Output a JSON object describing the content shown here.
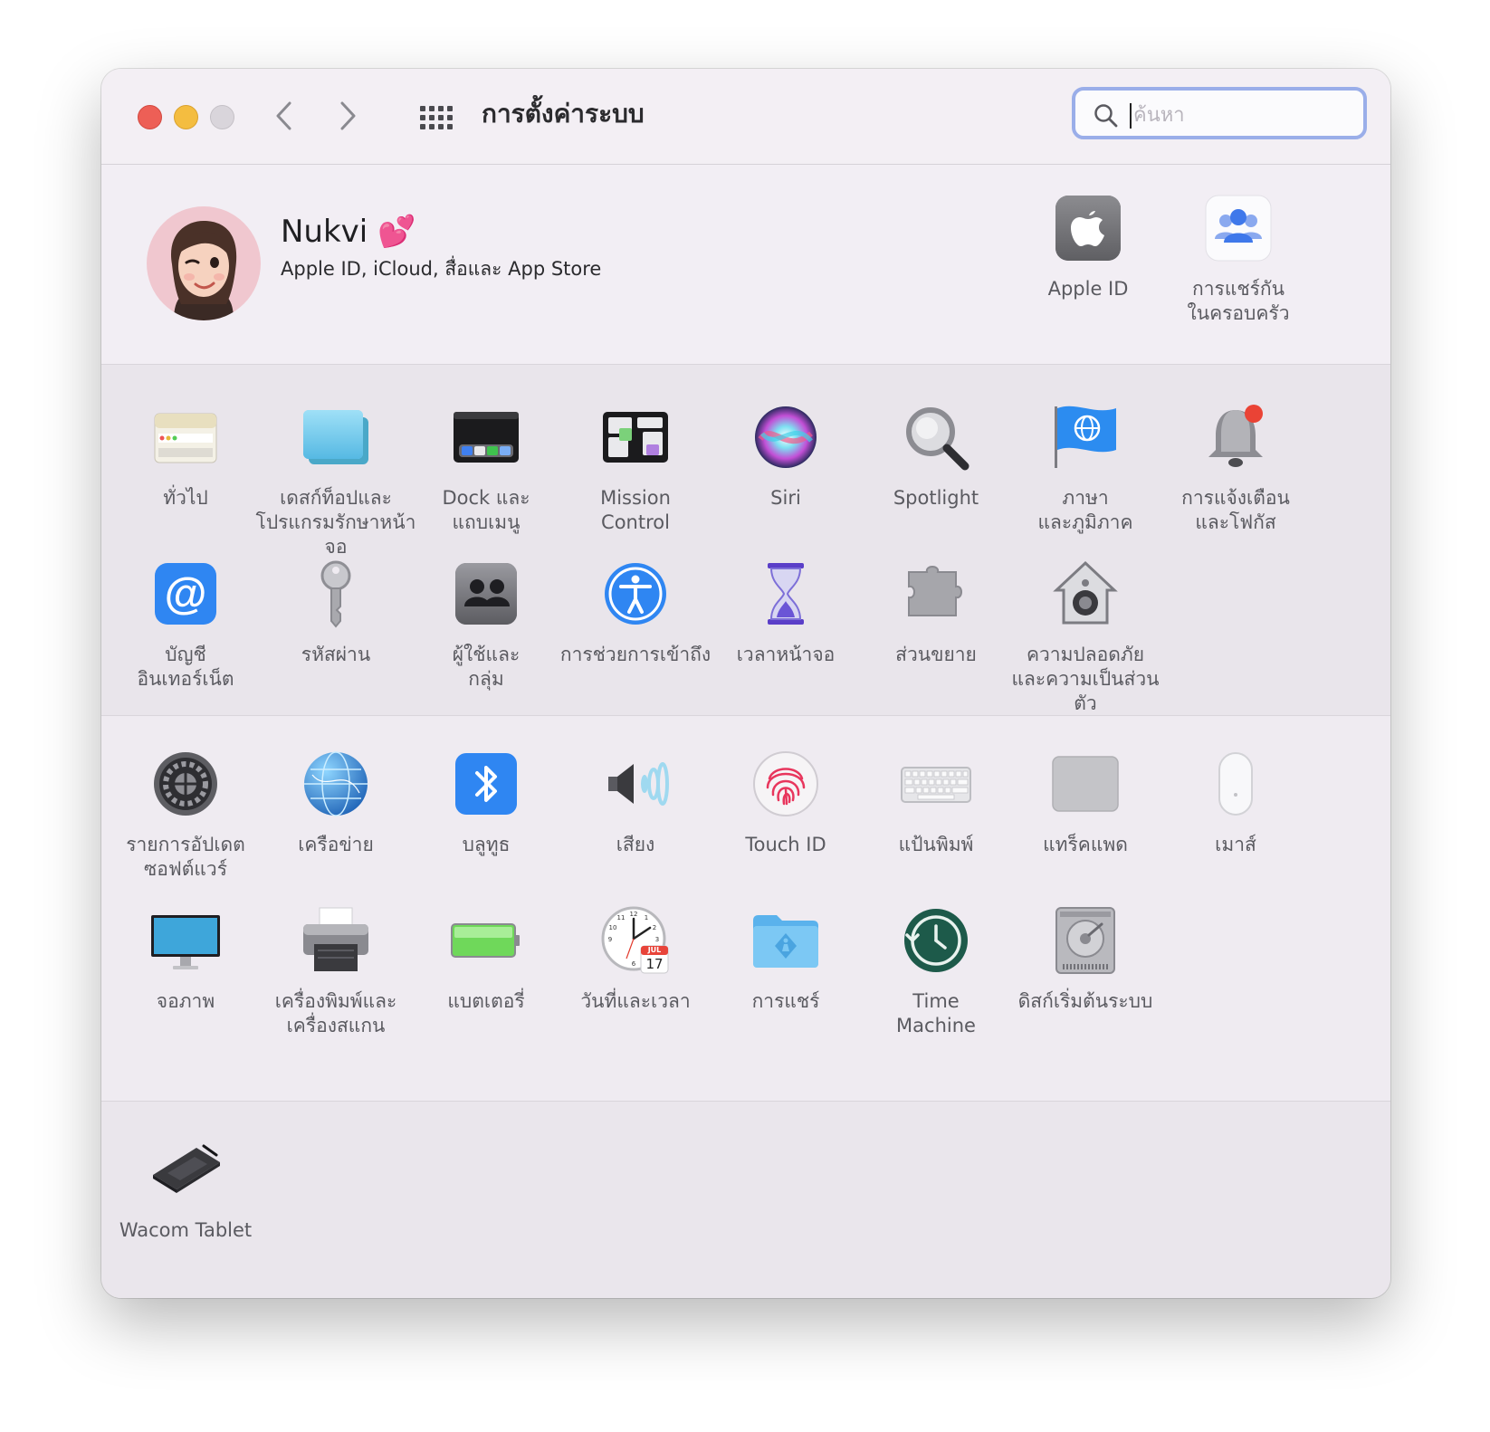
{
  "window": {
    "title": "การตั้งค่าระบบ",
    "search_placeholder": "ค้นหา"
  },
  "user": {
    "name": "Nukvi 💕",
    "subtitle": "Apple ID, iCloud, สื่อและ App Store"
  },
  "top_panes": [
    {
      "label": "Apple ID",
      "icon": "apple-id-icon"
    },
    {
      "label": "การแชร์กัน\nในครอบครัว",
      "icon": "family-sharing-icon"
    }
  ],
  "panes_personal": [
    {
      "label": "ทั่วไป",
      "icon": "general-icon"
    },
    {
      "label": "เดสก์ท็อปและ\nโปรแกรมรักษาหน้าจอ",
      "icon": "desktop-screensaver-icon"
    },
    {
      "label": "Dock และ\nแถบเมนู",
      "icon": "dock-menubar-icon"
    },
    {
      "label": "Mission\nControl",
      "icon": "mission-control-icon"
    },
    {
      "label": "Siri",
      "icon": "siri-icon"
    },
    {
      "label": "Spotlight",
      "icon": "spotlight-icon"
    },
    {
      "label": "ภาษา\nและภูมิภาค",
      "icon": "language-region-icon"
    },
    {
      "label": "การแจ้งเตือน\nและโฟกัส",
      "icon": "notifications-icon"
    },
    {
      "label": "บัญชี\nอินเทอร์เน็ต",
      "icon": "internet-accounts-icon"
    },
    {
      "label": "รหัสผ่าน",
      "icon": "passwords-key-icon"
    },
    {
      "label": "ผู้ใช้และ\nกลุ่ม",
      "icon": "users-groups-icon"
    },
    {
      "label": "การช่วยการเข้าถึง",
      "icon": "accessibility-icon"
    },
    {
      "label": "เวลาหน้าจอ",
      "icon": "screen-time-icon"
    },
    {
      "label": "ส่วนขยาย",
      "icon": "extensions-icon"
    },
    {
      "label": "ความปลอดภัย\nและความเป็นส่วนตัว",
      "icon": "security-privacy-icon"
    }
  ],
  "panes_hardware": [
    {
      "label": "รายการอัปเดต\nซอฟต์แวร์",
      "icon": "software-update-icon"
    },
    {
      "label": "เครือข่าย",
      "icon": "network-icon"
    },
    {
      "label": "บลูทูธ",
      "icon": "bluetooth-icon"
    },
    {
      "label": "เสียง",
      "icon": "sound-icon"
    },
    {
      "label": "Touch ID",
      "icon": "touch-id-icon"
    },
    {
      "label": "แป้นพิมพ์",
      "icon": "keyboard-icon"
    },
    {
      "label": "แทร็คแพด",
      "icon": "trackpad-icon"
    },
    {
      "label": "เมาส์",
      "icon": "mouse-icon"
    },
    {
      "label": "จอภาพ",
      "icon": "displays-icon"
    },
    {
      "label": "เครื่องพิมพ์และ\nเครื่องสแกน",
      "icon": "printers-scanners-icon"
    },
    {
      "label": "แบตเตอรี่",
      "icon": "battery-icon"
    },
    {
      "label": "วันที่และเวลา",
      "icon": "date-time-icon",
      "clock_badge_month": "JUL",
      "clock_badge_day": "17"
    },
    {
      "label": "การแชร์",
      "icon": "sharing-icon"
    },
    {
      "label": "Time\nMachine",
      "icon": "time-machine-icon"
    },
    {
      "label": "ดิสก์เริ่มต้นระบบ",
      "icon": "startup-disk-icon"
    }
  ],
  "panes_other": [
    {
      "label": "Wacom Tablet",
      "icon": "wacom-tablet-icon"
    }
  ],
  "colors": {
    "window_bg": "#efebf1",
    "search_focus_ring": "#9aaee9",
    "traffic_red": "#ed5f56",
    "traffic_yellow": "#f4bd40",
    "label_text": "#5a5a60",
    "accent_blue": "#2f7df6"
  }
}
